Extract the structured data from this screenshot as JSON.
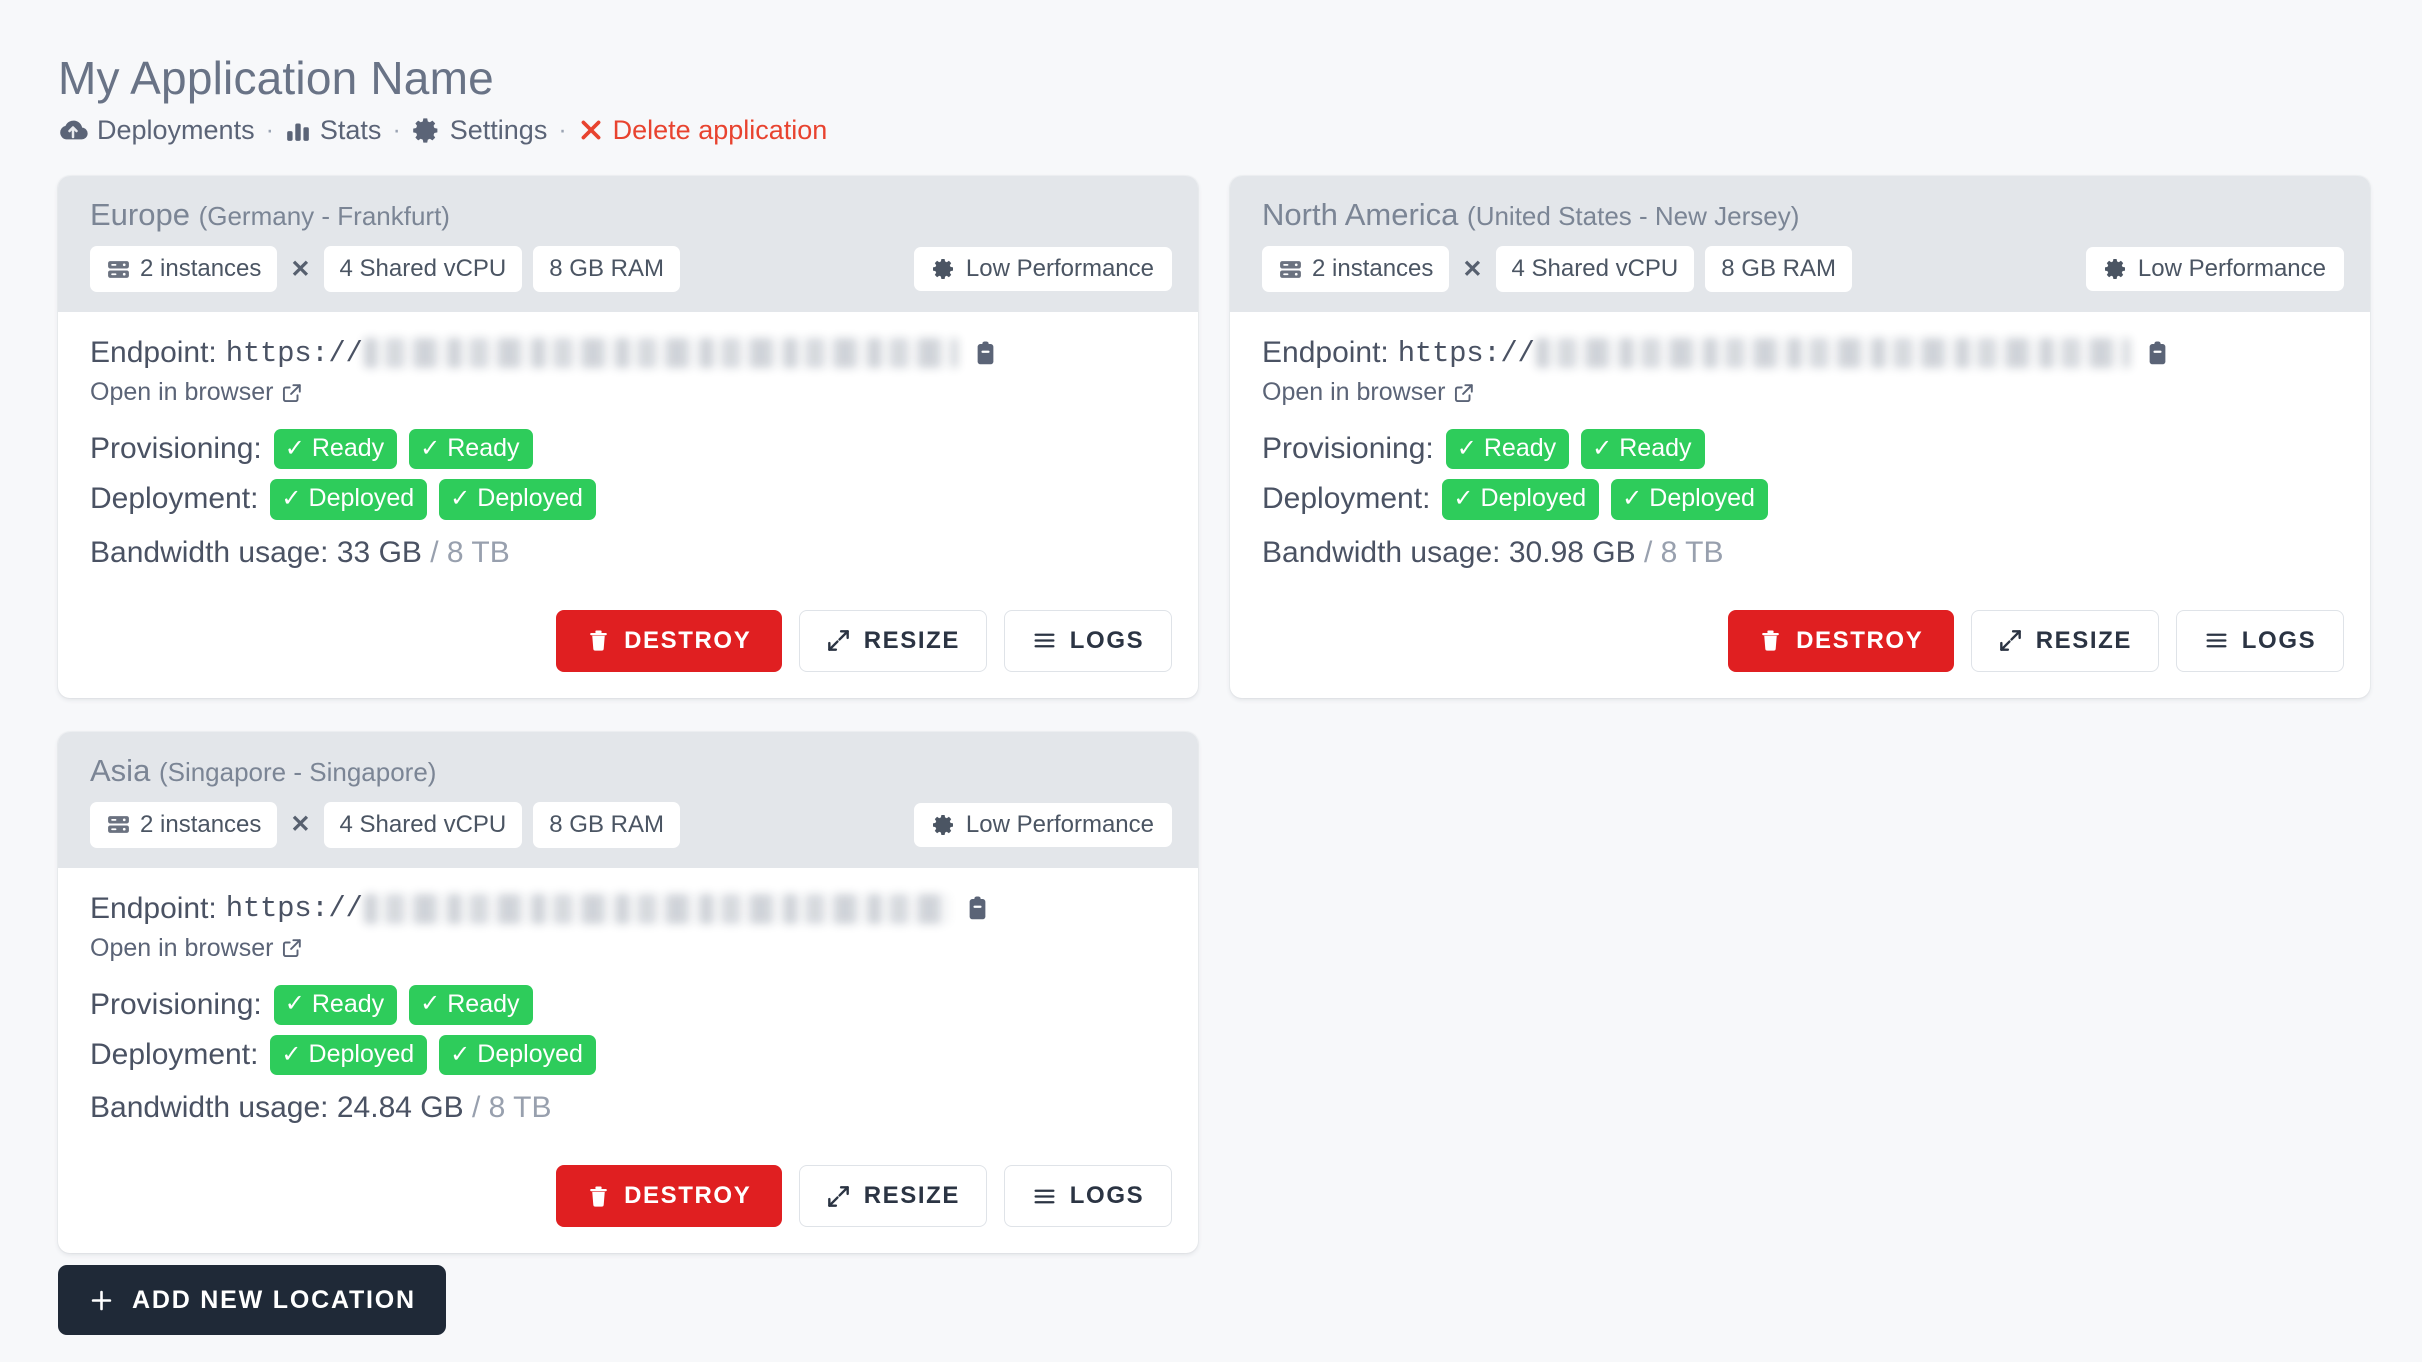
{
  "header": {
    "app_title": "My Application Name",
    "nav": [
      {
        "label": "Deployments",
        "icon": "cloud-upload-icon",
        "danger": false
      },
      {
        "label": "Stats",
        "icon": "bar-chart-icon",
        "danger": false
      },
      {
        "label": "Settings",
        "icon": "gear-icon",
        "danger": false
      },
      {
        "label": "Delete application",
        "icon": "close-x-icon",
        "danger": true
      }
    ],
    "separator": "·"
  },
  "labels": {
    "endpoint": "Endpoint:",
    "scheme": "https://",
    "open_in_browser": "Open in browser",
    "provisioning": "Provisioning:",
    "deployment": "Deployment:",
    "bandwidth": "Bandwidth usage:",
    "multiplier": "✕",
    "copy_icon": "clipboard-icon",
    "external_link_icon": "external-link-icon",
    "instances_icon": "server-stack-icon",
    "performance_icon": "gear-icon",
    "check_icon": "✓"
  },
  "buttons": {
    "destroy": "DESTROY",
    "resize": "RESIZE",
    "logs": "LOGS",
    "destroy_icon": "trash-icon",
    "resize_icon": "expand-arrows-icon",
    "logs_icon": "list-lines-icon",
    "add_location": "ADD NEW LOCATION",
    "add_location_icon": "plus-icon"
  },
  "colors": {
    "page_bg": "#f7f8fa",
    "card_header_bg": "#e3e6ea",
    "card_body_bg": "#ffffff",
    "success_badge": "#2ecc5b",
    "danger": "#e01f21",
    "delete_link": "#e8432f",
    "dark_button": "#1f2937",
    "text": "#4a5263",
    "muted_text": "#7b8595"
  },
  "locations": [
    {
      "region": "Europe",
      "place": "(Germany - Frankfurt)",
      "instances": "2 instances",
      "vcpu": "4 Shared vCPU",
      "ram": "8 GB RAM",
      "performance": "Low Performance",
      "provisioning": [
        "Ready",
        "Ready"
      ],
      "deployment": [
        "Deployed",
        "Deployed"
      ],
      "bandwidth_used": "33 GB",
      "bandwidth_total": "/ 8 TB"
    },
    {
      "region": "North America",
      "place": "(United States - New Jersey)",
      "instances": "2 instances",
      "vcpu": "4 Shared vCPU",
      "ram": "8 GB RAM",
      "performance": "Low Performance",
      "provisioning": [
        "Ready",
        "Ready"
      ],
      "deployment": [
        "Deployed",
        "Deployed"
      ],
      "bandwidth_used": "30.98 GB",
      "bandwidth_total": "/ 8 TB"
    },
    {
      "region": "Asia",
      "place": "(Singapore - Singapore)",
      "instances": "2 instances",
      "vcpu": "4 Shared vCPU",
      "ram": "8 GB RAM",
      "performance": "Low Performance",
      "provisioning": [
        "Ready",
        "Ready"
      ],
      "deployment": [
        "Deployed",
        "Deployed"
      ],
      "bandwidth_used": "24.84 GB",
      "bandwidth_total": "/ 8 TB"
    }
  ]
}
